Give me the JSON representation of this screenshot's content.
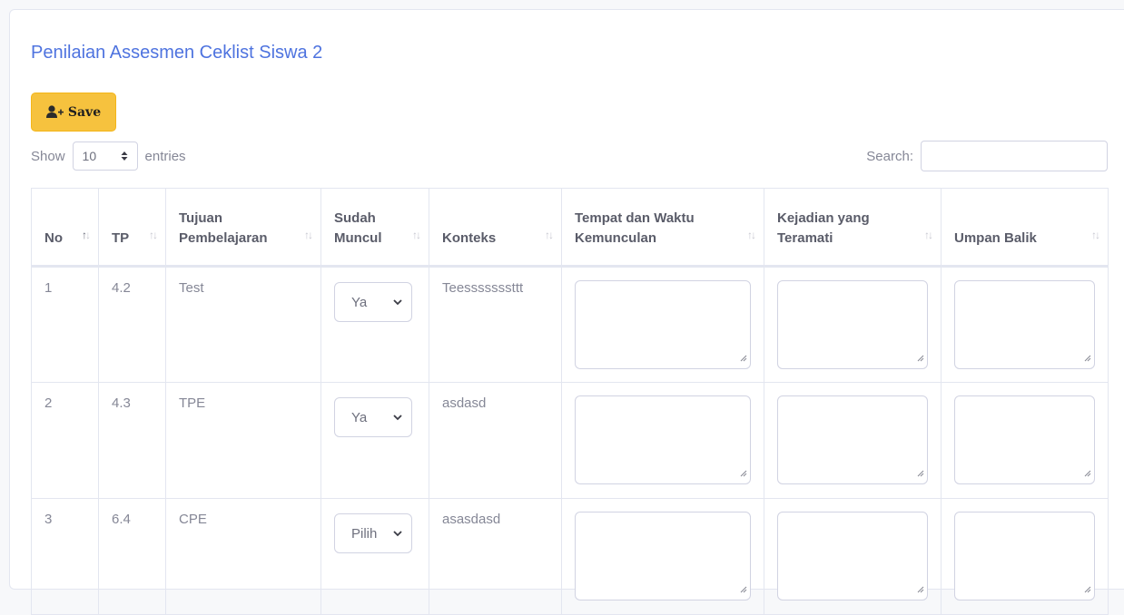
{
  "page": {
    "title": "Penilaian Assesmen Ceklist Siswa 2"
  },
  "toolbar": {
    "save_label": "Save"
  },
  "length": {
    "show_label": "Show",
    "value": "10",
    "entries_label": "entries"
  },
  "search": {
    "label": "Search:",
    "value": ""
  },
  "table": {
    "columns": [
      "No",
      "TP",
      "Tujuan Pembelajaran",
      "Sudah Muncul",
      "Konteks",
      "Tempat dan Waktu Kemunculan",
      "Kejadian yang Teramati",
      "Umpan Balik"
    ],
    "rows": [
      {
        "no": "1",
        "tp": "4.2",
        "tujuan": "Test",
        "sudah_muncul": "Ya",
        "konteks": "Teesssssssttt",
        "tempat": "",
        "kejadian": "",
        "umpan": ""
      },
      {
        "no": "2",
        "tp": "4.3",
        "tujuan": "TPE",
        "sudah_muncul": "Ya",
        "konteks": "asdasd",
        "tempat": "",
        "kejadian": "",
        "umpan": ""
      },
      {
        "no": "3",
        "tp": "6.4",
        "tujuan": "CPE",
        "sudah_muncul": "Pilih",
        "konteks": "asasdasd",
        "tempat": "",
        "kejadian": "",
        "umpan": ""
      }
    ]
  },
  "colors": {
    "accent": "#4e73df",
    "warning": "#f6c23e",
    "text_muted": "#858796",
    "header_text": "#5a5c69"
  },
  "icons": {
    "save": "user-plus-icon",
    "sort": "sort-icon",
    "select": "chevron-down-icon",
    "resize": "resize-grip-icon"
  }
}
